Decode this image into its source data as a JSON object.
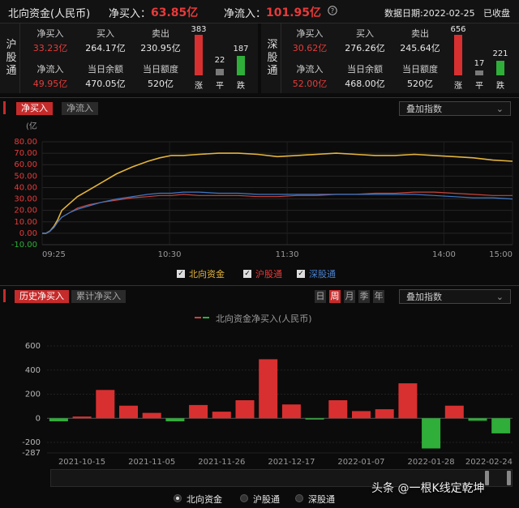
{
  "header": {
    "title": "北向资金(人民币)",
    "net_buy_label": "净买入：",
    "net_buy_value": "63.85亿",
    "net_inflow_label": "净流入：",
    "net_inflow_value": "101.95亿",
    "help_icon": "question-circle-icon",
    "date_label": "数据日期:2022-02-25",
    "status": "已收盘"
  },
  "hgt": {
    "name_chars": [
      "沪",
      "股",
      "通"
    ],
    "net_buy_label": "净买入",
    "net_buy": "33.23亿",
    "buy_label": "买入",
    "buy": "264.17亿",
    "sell_label": "卖出",
    "sell": "230.95亿",
    "net_inflow_label": "净流入",
    "net_inflow": "49.95亿",
    "balance_label": "当日余额",
    "balance": "470.05亿",
    "quota_label": "当日额度",
    "quota": "520亿",
    "up_count": 383,
    "flat_count": 22,
    "down_count": 187,
    "up_label": "涨",
    "flat_label": "平",
    "down_label": "跌"
  },
  "sgt": {
    "name_chars": [
      "深",
      "股",
      "通"
    ],
    "net_buy_label": "净买入",
    "net_buy": "30.62亿",
    "buy_label": "买入",
    "buy": "276.26亿",
    "sell_label": "卖出",
    "sell": "245.64亿",
    "net_inflow_label": "净流入",
    "net_inflow": "52.00亿",
    "balance_label": "当日余额",
    "balance": "468.00亿",
    "quota_label": "当日额度",
    "quota": "520亿",
    "up_count": 656,
    "flat_count": 17,
    "down_count": 221,
    "up_label": "涨",
    "flat_label": "平",
    "down_label": "跌"
  },
  "intraday": {
    "tabs": [
      "净买入",
      "净流入"
    ],
    "active_tab": 0,
    "overlay_dropdown": "叠加指数",
    "legend": [
      "北向资金",
      "沪股通",
      "深股通"
    ]
  },
  "history": {
    "tabs": [
      "历史净买入",
      "累计净买入"
    ],
    "active_tab": 0,
    "periods": [
      "日",
      "周",
      "月",
      "季",
      "年"
    ],
    "active_period": 1,
    "overlay_dropdown": "叠加指数",
    "series_legend": "北向资金净买入(人民币)",
    "radios": [
      "北向资金",
      "沪股通",
      "深股通"
    ],
    "active_radio": 0
  },
  "colors": {
    "north": "#e3b33b",
    "hgt": "#c8453c",
    "sgt": "#3f78c8",
    "up": "#d83030",
    "down": "#2fae3a",
    "accent": "#c62b2b"
  },
  "watermark": "头条 @一根K线定乾坤",
  "chart_data": [
    {
      "type": "line",
      "unit": "(亿",
      "x_ticks": [
        "09:25",
        "10:30",
        "11:30",
        "14:00",
        "15:00"
      ],
      "y_ticks": [
        -10,
        0,
        10,
        20,
        30,
        40,
        50,
        60,
        70,
        80
      ],
      "y_tick_labels": [
        "-10.00",
        "0.00",
        "10.00",
        "20.00",
        "30.00",
        "40.00",
        "50.00",
        "60.00",
        "70.00",
        "80.00"
      ],
      "ylim": [
        -10,
        80
      ],
      "x_index": [
        0,
        2,
        4,
        6,
        8,
        10,
        14,
        18,
        24,
        30,
        38,
        46,
        54,
        60,
        66,
        72,
        80,
        90,
        100,
        110,
        120,
        130,
        140,
        150,
        160,
        170,
        180,
        190,
        200,
        210,
        220,
        230,
        240
      ],
      "series": [
        {
          "name": "北向资金",
          "values": [
            0,
            0,
            2,
            6,
            12,
            20,
            26,
            32,
            38,
            44,
            52,
            58,
            63,
            66,
            68,
            68,
            69,
            70,
            70,
            69,
            67,
            68,
            69,
            70,
            69,
            68,
            68,
            69,
            68,
            67,
            66,
            64,
            63
          ]
        },
        {
          "name": "沪股通",
          "values": [
            0,
            0,
            2,
            5,
            10,
            14,
            18,
            22,
            25,
            27,
            29,
            31,
            32,
            33,
            33,
            34,
            33,
            33,
            33,
            32,
            32,
            33,
            33,
            34,
            34,
            35,
            35,
            36,
            36,
            35,
            34,
            33,
            33
          ]
        },
        {
          "name": "深股通",
          "values": [
            0,
            0,
            2,
            5,
            10,
            14,
            18,
            21,
            24,
            27,
            30,
            32,
            34,
            35,
            35,
            36,
            36,
            35,
            35,
            34,
            34,
            34,
            34,
            34,
            34,
            34,
            34,
            34,
            33,
            32,
            31,
            31,
            30
          ]
        }
      ]
    },
    {
      "type": "bar",
      "series_name": "北向资金净买入(人民币)",
      "x_tick_labels": [
        "2021-10-15",
        "2021-11-05",
        "2021-11-26",
        "2021-12-17",
        "2022-01-07",
        "2022-01-28",
        "2022-02-24"
      ],
      "y_ticks": [
        -287,
        -200,
        0,
        200,
        400,
        600
      ],
      "ylim": [
        -287,
        600
      ],
      "values": [
        -25,
        15,
        235,
        105,
        45,
        -25,
        110,
        55,
        150,
        490,
        115,
        -10,
        150,
        60,
        75,
        290,
        -250,
        105,
        -20,
        -125
      ]
    }
  ]
}
